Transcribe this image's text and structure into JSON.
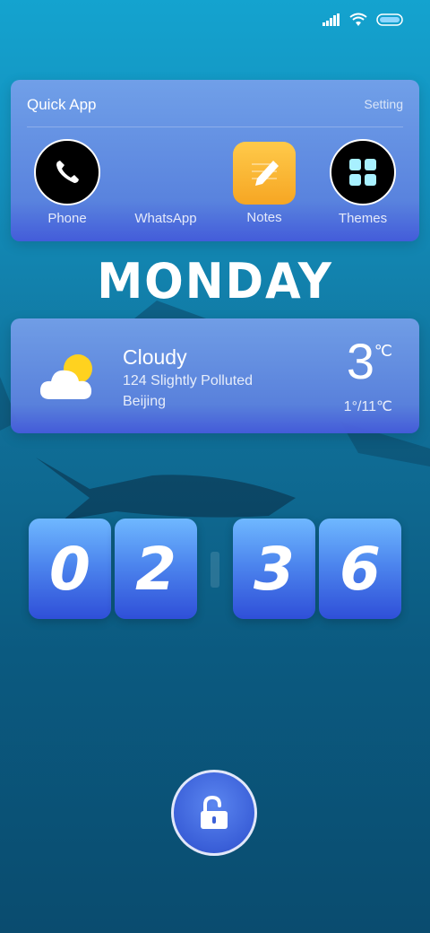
{
  "status_bar": {
    "signal_icon": "signal-icon",
    "wifi_icon": "wifi-icon",
    "battery_icon": "battery-icon"
  },
  "quick_app": {
    "title": "Quick App",
    "setting_label": "Setting",
    "apps": [
      {
        "label": "Phone",
        "icon": "phone-icon"
      },
      {
        "label": "WhatsApp",
        "icon": ""
      },
      {
        "label": "Notes",
        "icon": "notes-icon"
      },
      {
        "label": "Themes",
        "icon": "themes-icon"
      }
    ]
  },
  "day": "MONDAY",
  "weather": {
    "icon": "partly-cloudy-icon",
    "condition": "Cloudy",
    "air_quality": "124  Slightly Polluted",
    "city": "Beijing",
    "temperature": "3",
    "unit": "℃",
    "range": "1°/11℃"
  },
  "clock": {
    "digits": [
      "0",
      "2",
      "3",
      "6"
    ]
  },
  "unlock_icon": "unlock-icon",
  "colors": {
    "card": "#6f93e8",
    "digit_top": "#6fb8ff",
    "digit_bottom": "#2f4fd8",
    "notes": "#f6a623"
  }
}
